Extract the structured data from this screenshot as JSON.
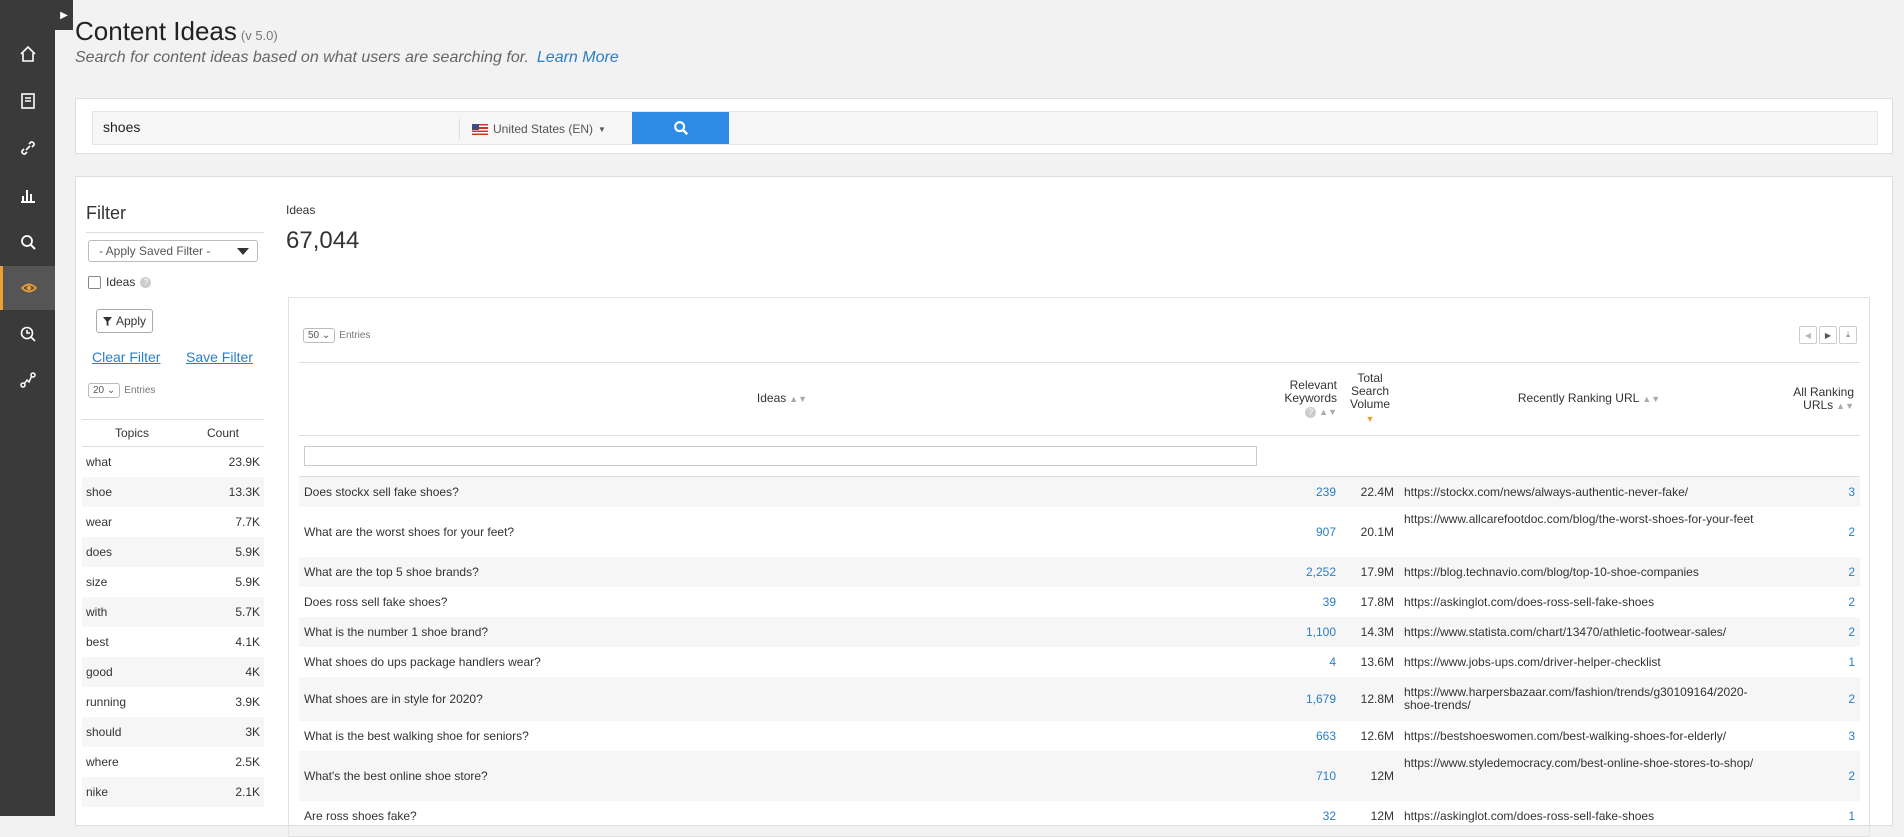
{
  "header": {
    "title": "Content Ideas",
    "version": "(v 5.0)",
    "subtitle": "Search for content ideas based on what users are searching for.",
    "learn_more": "Learn More"
  },
  "search": {
    "query": "shoes",
    "country": "United States (EN)"
  },
  "filter": {
    "heading": "Filter",
    "saved_filter_placeholder": "- Apply Saved Filter -",
    "ideas_checkbox_label": "Ideas",
    "apply_label": "Apply",
    "clear_filter": "Clear Filter",
    "save_filter": "Save Filter",
    "entries_value": "20",
    "entries_label": "Entries",
    "topics_header": "Topics",
    "count_header": "Count",
    "topics": [
      {
        "topic": "what",
        "count": "23.9K"
      },
      {
        "topic": "shoe",
        "count": "13.3K"
      },
      {
        "topic": "wear",
        "count": "7.7K"
      },
      {
        "topic": "does",
        "count": "5.9K"
      },
      {
        "topic": "size",
        "count": "5.9K"
      },
      {
        "topic": "with",
        "count": "5.7K"
      },
      {
        "topic": "best",
        "count": "4.1K"
      },
      {
        "topic": "good",
        "count": "4K"
      },
      {
        "topic": "running",
        "count": "3.9K"
      },
      {
        "topic": "should",
        "count": "3K"
      },
      {
        "topic": "where",
        "count": "2.5K"
      },
      {
        "topic": "nike",
        "count": "2.1K"
      }
    ]
  },
  "results": {
    "ideas_label": "Ideas",
    "ideas_count": "67,044",
    "entries_value": "50",
    "entries_label": "Entries",
    "columns": {
      "ideas": "Ideas",
      "relevant_keywords": "Relevant Keywords",
      "total_search_volume": "Total Search Volume",
      "recently_ranking_url": "Recently Ranking URL",
      "all_ranking_urls": "All Ranking URLs"
    },
    "rows": [
      {
        "idea": "Does stockx sell fake shoes?",
        "keywords": "239",
        "volume": "22.4M",
        "url": "https://stockx.com/news/always-authentic-never-fake/",
        "ranking": "3"
      },
      {
        "idea": "What are the worst shoes for your feet?",
        "keywords": "907",
        "volume": "20.1M",
        "url": "https://www.allcarefootdoc.com/blog/the-worst-shoes-for-your-feet",
        "ranking": "2"
      },
      {
        "idea": "What are the top 5 shoe brands?",
        "keywords": "2,252",
        "volume": "17.9M",
        "url": "https://blog.technavio.com/blog/top-10-shoe-companies",
        "ranking": "2"
      },
      {
        "idea": "Does ross sell fake shoes?",
        "keywords": "39",
        "volume": "17.8M",
        "url": "https://askinglot.com/does-ross-sell-fake-shoes",
        "ranking": "2"
      },
      {
        "idea": "What is the number 1 shoe brand?",
        "keywords": "1,100",
        "volume": "14.3M",
        "url": "https://www.statista.com/chart/13470/athletic-footwear-sales/",
        "ranking": "2"
      },
      {
        "idea": "What shoes do ups package handlers wear?",
        "keywords": "4",
        "volume": "13.6M",
        "url": "https://www.jobs-ups.com/driver-helper-checklist",
        "ranking": "1"
      },
      {
        "idea": "What shoes are in style for 2020?",
        "keywords": "1,679",
        "volume": "12.8M",
        "url": "https://www.harpersbazaar.com/fashion/trends/g30109164/2020-shoe-trends/",
        "ranking": "2"
      },
      {
        "idea": "What is the best walking shoe for seniors?",
        "keywords": "663",
        "volume": "12.6M",
        "url": "https://bestshoeswomen.com/best-walking-shoes-for-elderly/",
        "ranking": "3"
      },
      {
        "idea": "What's the best online shoe store?",
        "keywords": "710",
        "volume": "12M",
        "url": "https://www.styledemocracy.com/best-online-shoe-stores-to-shop/",
        "ranking": "2"
      },
      {
        "idea": "Are ross shoes fake?",
        "keywords": "32",
        "volume": "12M",
        "url": "https://askinglot.com/does-ross-sell-fake-shoes",
        "ranking": "1"
      }
    ]
  },
  "colors": {
    "accent": "#f0a030",
    "link": "#2a7ec8",
    "search_button": "#2e8be6",
    "sidebar": "#3a3a3a"
  }
}
